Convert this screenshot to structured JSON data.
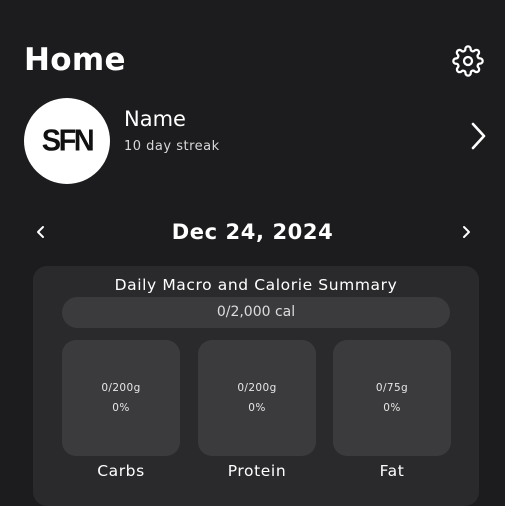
{
  "header": {
    "title": "Home",
    "settings_icon": "gear-icon"
  },
  "profile": {
    "avatar_logo": "SFN",
    "name": "Name",
    "streak": "10 day streak",
    "chevron_icon": "chevron-right-icon"
  },
  "date_nav": {
    "prev_icon": "chevron-left-icon",
    "date": "Dec 24, 2024",
    "next_icon": "chevron-right-icon"
  },
  "summary": {
    "title": "Daily Macro and Calorie Summary",
    "calories": {
      "text": "0/2,000 cal",
      "progress": 0
    },
    "macros": [
      {
        "label": "Carbs",
        "amount": "0/200g",
        "percent": "0%"
      },
      {
        "label": "Protein",
        "amount": "0/200g",
        "percent": "0%"
      },
      {
        "label": "Fat",
        "amount": "0/75g",
        "percent": "0%"
      }
    ]
  },
  "colors": {
    "background": "#1c1c1e",
    "card": "#2a2a2c",
    "tile": "#3b3b3d",
    "text": "#ffffff"
  }
}
